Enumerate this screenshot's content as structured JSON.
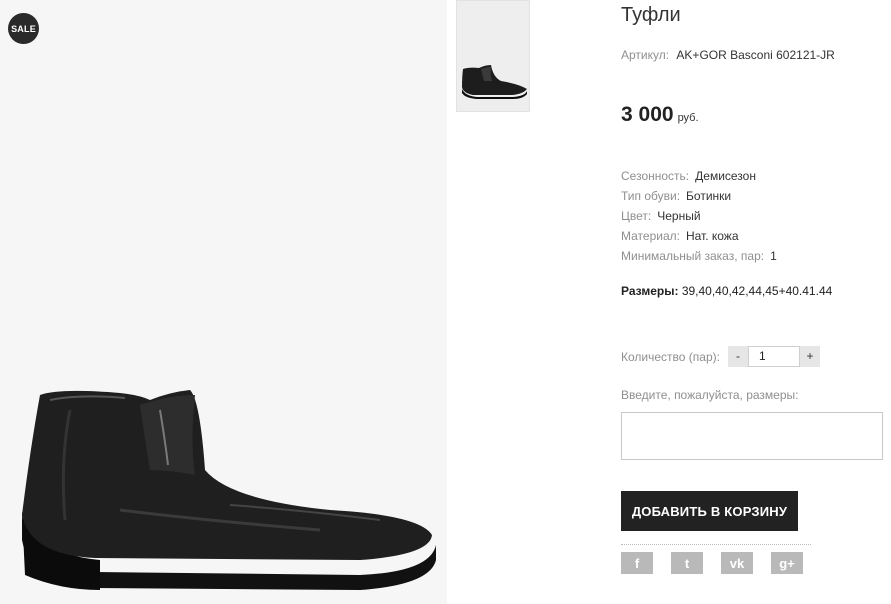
{
  "badge": {
    "sale": "SALE"
  },
  "product": {
    "title": "Туфли",
    "sku_label": "Артикул:",
    "sku_value": "AK+GOR Basconi 602121-JR",
    "price_amount": "3 000",
    "price_currency": "руб."
  },
  "props": [
    {
      "label": "Сезонность:",
      "value": "Демисезон"
    },
    {
      "label": "Тип обуви:",
      "value": "Ботинки"
    },
    {
      "label": "Цвет:",
      "value": "Черный"
    },
    {
      "label": "Материал:",
      "value": "Нат. кожа"
    },
    {
      "label": "Минимальный заказ, пар:",
      "value": "1"
    }
  ],
  "sizes": {
    "label": "Размеры:",
    "value": "39,40,40,42,44,45+40.41.44"
  },
  "quantity": {
    "label": "Количество (пар):",
    "minus": "-",
    "value": "1",
    "plus": "+"
  },
  "sizes_input": {
    "label": "Введите, пожалуйста, размеры:",
    "value": ""
  },
  "cart": {
    "add_label": "ДОБАВИТЬ В КОРЗИНУ"
  },
  "social": [
    {
      "icon": "facebook-icon",
      "glyph": "f"
    },
    {
      "icon": "twitter-icon",
      "glyph": "t"
    },
    {
      "icon": "vk-icon",
      "glyph": "vk"
    },
    {
      "icon": "googleplus-icon",
      "glyph": "g+"
    }
  ],
  "colors": {
    "accent": "#222222",
    "muted": "#8f8f8f",
    "social": "#b9b9b9"
  }
}
